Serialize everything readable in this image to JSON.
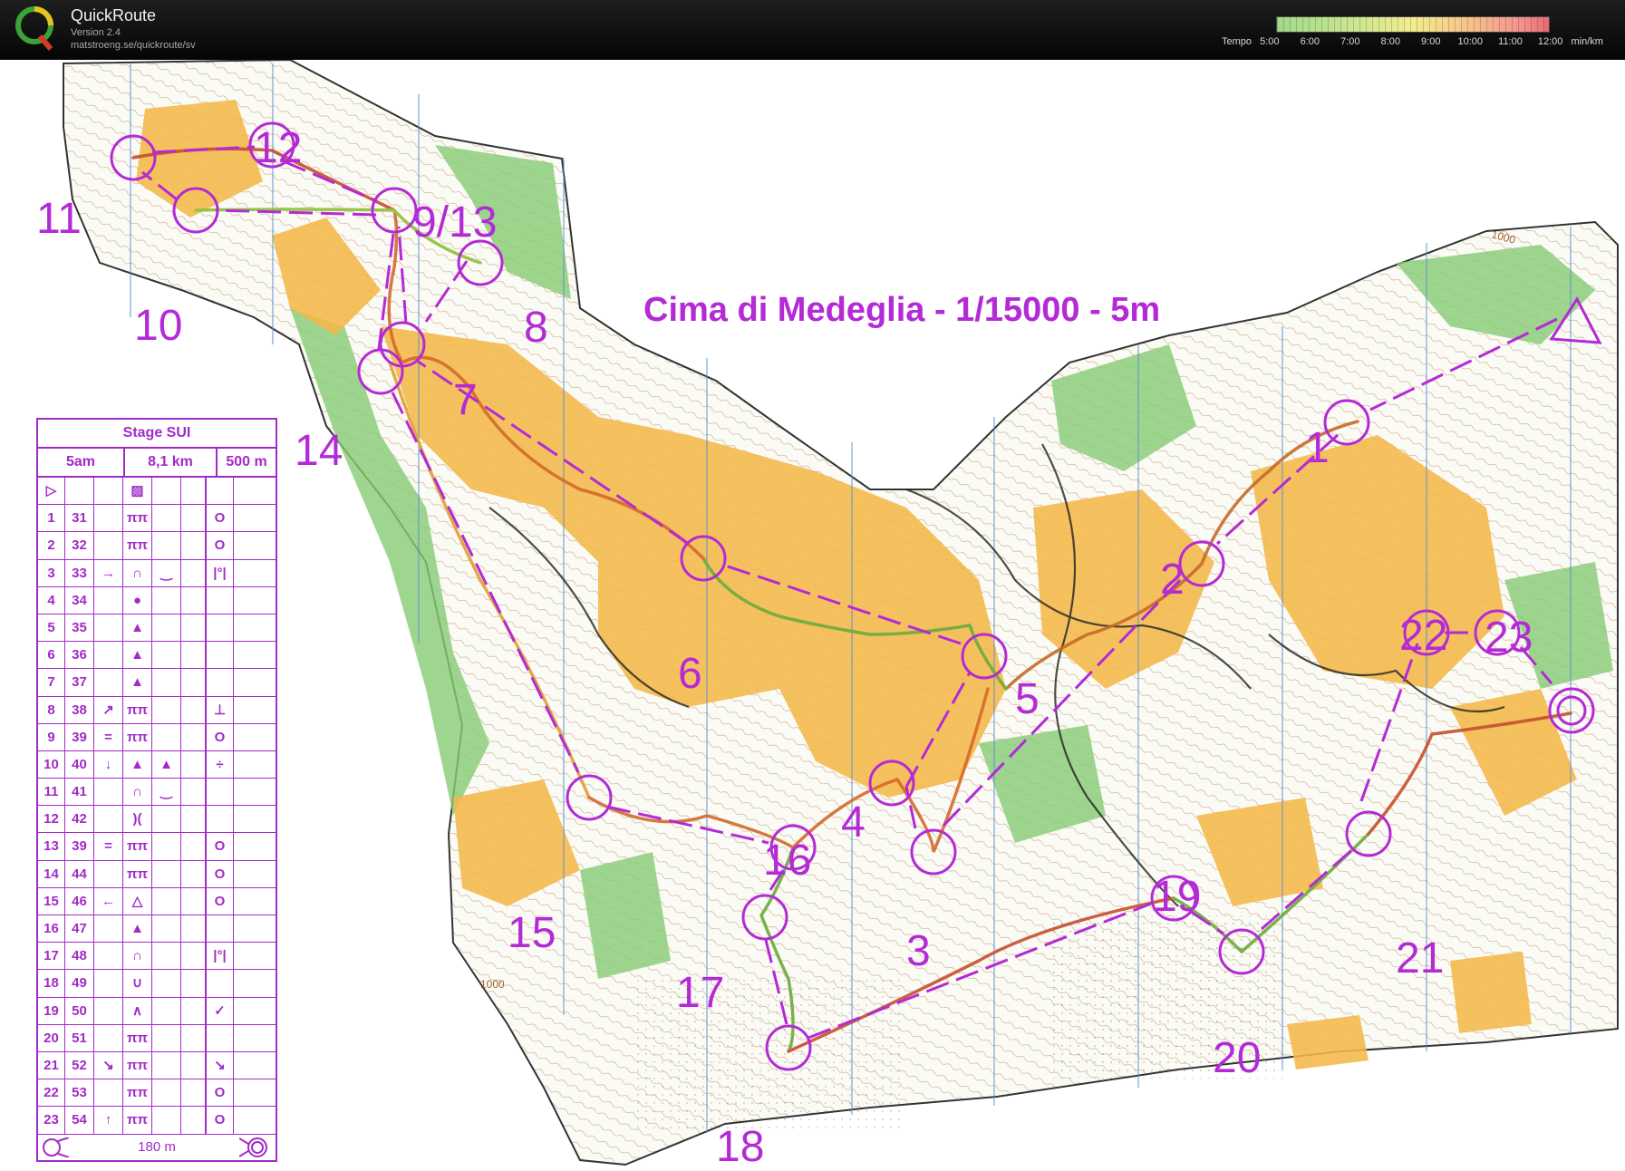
{
  "app": {
    "name": "QuickRoute",
    "version": "Version 2.4",
    "url": "matstroeng.se/quickroute/sv"
  },
  "tempo_legend": {
    "label": "Tempo",
    "ticks": [
      "5:00",
      "6:00",
      "7:00",
      "8:00",
      "9:00",
      "10:00",
      "11:00",
      "12:00"
    ],
    "unit": "min/km"
  },
  "map": {
    "title": "Cima di Medeglia - 1/15000 - 5m",
    "contour_labels": [
      "1000",
      "1000"
    ],
    "colors": {
      "course": "#b42ad6",
      "open": "#f4b84a",
      "forest_green": "#7dc46a",
      "contour": "#a06030"
    }
  },
  "controls": [
    "1",
    "2",
    "3",
    "4",
    "5",
    "6",
    "7",
    "8",
    "9/13",
    "10",
    "11",
    "12",
    "14",
    "15",
    "16",
    "17",
    "18",
    "19",
    "20",
    "21",
    "22",
    "23"
  ],
  "control_description": {
    "title": "Stage SUI",
    "class": "5am",
    "length": "8,1 km",
    "climb": "500 m",
    "start_symbol": "start-triangle",
    "rows": [
      {
        "n": "1",
        "code": "31",
        "d": "",
        "e": "ππ",
        "f": "",
        "h": "O"
      },
      {
        "n": "2",
        "code": "32",
        "d": "",
        "e": "ππ",
        "f": "",
        "h": "O"
      },
      {
        "n": "3",
        "code": "33",
        "d": "→",
        "e": "∩",
        "f": "‿",
        "h": "|°|"
      },
      {
        "n": "4",
        "code": "34",
        "d": "",
        "e": "●",
        "f": "",
        "h": ""
      },
      {
        "n": "5",
        "code": "35",
        "d": "",
        "e": "▲",
        "f": "",
        "h": ""
      },
      {
        "n": "6",
        "code": "36",
        "d": "",
        "e": "▲",
        "f": "",
        "h": ""
      },
      {
        "n": "7",
        "code": "37",
        "d": "",
        "e": "▲",
        "f": "",
        "h": ""
      },
      {
        "n": "8",
        "code": "38",
        "d": "↗",
        "e": "ππ",
        "f": "",
        "h": "⊥"
      },
      {
        "n": "9",
        "code": "39",
        "d": "=",
        "e": "ππ",
        "f": "",
        "h": "O"
      },
      {
        "n": "10",
        "code": "40",
        "d": "↓",
        "e": "▲",
        "f": "▲",
        "h": "÷"
      },
      {
        "n": "11",
        "code": "41",
        "d": "",
        "e": "∩",
        "f": "‿",
        "h": ""
      },
      {
        "n": "12",
        "code": "42",
        "d": "",
        "e": ")(",
        "f": "",
        "h": ""
      },
      {
        "n": "13",
        "code": "39",
        "d": "=",
        "e": "ππ",
        "f": "",
        "h": "O"
      },
      {
        "n": "14",
        "code": "44",
        "d": "",
        "e": "ππ",
        "f": "",
        "h": "O"
      },
      {
        "n": "15",
        "code": "46",
        "d": "←",
        "e": "△",
        "f": "",
        "h": "O"
      },
      {
        "n": "16",
        "code": "47",
        "d": "",
        "e": "▲",
        "f": "",
        "h": ""
      },
      {
        "n": "17",
        "code": "48",
        "d": "",
        "e": "∩",
        "f": "",
        "h": "|°|"
      },
      {
        "n": "18",
        "code": "49",
        "d": "",
        "e": "∪",
        "f": "",
        "h": ""
      },
      {
        "n": "19",
        "code": "50",
        "d": "",
        "e": "∧",
        "f": "",
        "h": "✓"
      },
      {
        "n": "20",
        "code": "51",
        "d": "",
        "e": "ππ",
        "f": "",
        "h": ""
      },
      {
        "n": "21",
        "code": "52",
        "d": "↘",
        "e": "ππ",
        "f": "",
        "h": "↘"
      },
      {
        "n": "22",
        "code": "53",
        "d": "",
        "e": "ππ",
        "f": "",
        "h": "O"
      },
      {
        "n": "23",
        "code": "54",
        "d": "↑",
        "e": "ππ",
        "f": "",
        "h": "O"
      }
    ],
    "finish_distance": "180 m"
  }
}
